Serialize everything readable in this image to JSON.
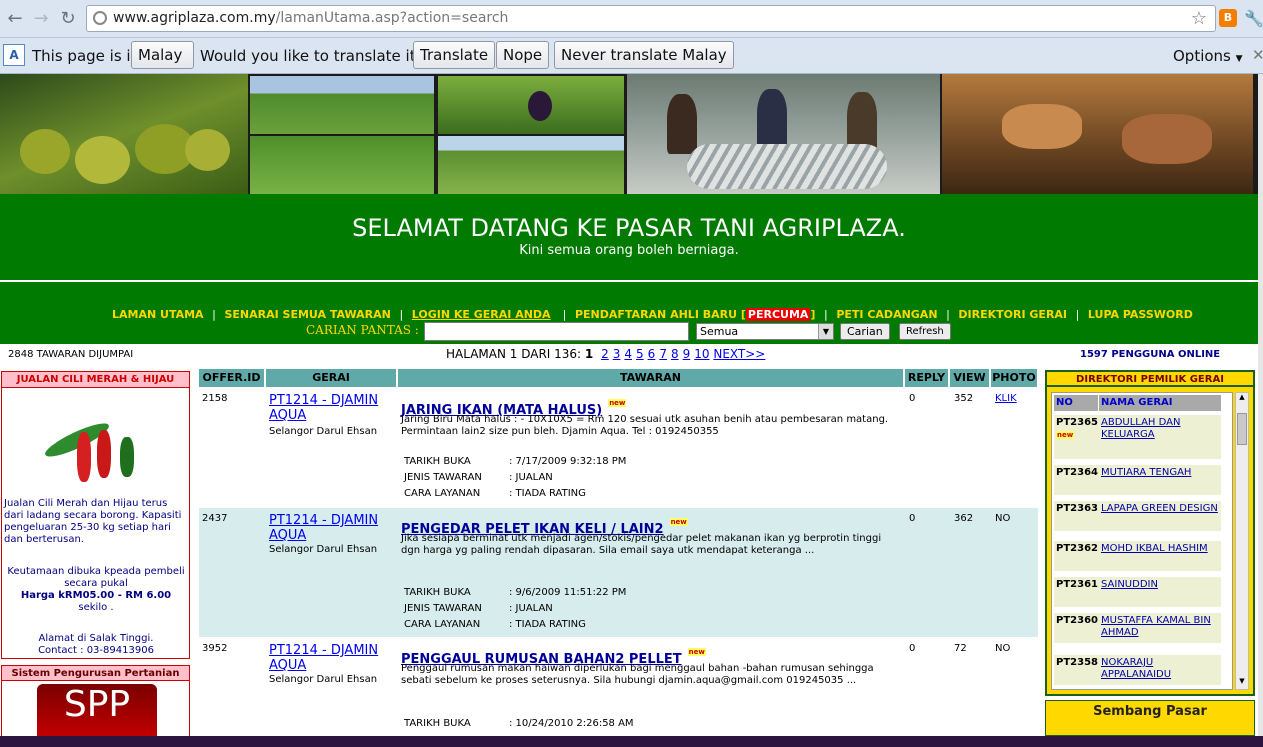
{
  "browser": {
    "url_host": "www.agriplaza.com.my",
    "url_path": "/lamanUtama.asp?action=search",
    "translate_text_prefix": "This page is in",
    "translate_language": "Malay",
    "translate_question": "Would you like to translate it?",
    "translate_btn": "Translate",
    "nope_btn": "Nope",
    "never_btn": "Never translate Malay",
    "options_btn": "Options"
  },
  "site": {
    "welcome_title": "SELAMAT DATANG KE PASAR TANI AGRIPLAZA.",
    "welcome_sub": "Kini semua orang boleh berniaga.",
    "nav": [
      "LAMAN UTAMA",
      "SENARAI SEMUA TAWARAN",
      "LOGIN KE GERAI ANDA",
      "PENDAFTARAN AHLI BARU [",
      "PERCUMA",
      "]",
      "PETI CADANGAN",
      "DIREKTORI GERAI",
      "LUPA PASSWORD"
    ],
    "search_label": "CARIAN PANTAS :",
    "search_value": "",
    "search_select": "Semua",
    "search_btn": "Carian",
    "refresh_btn": "Refresh"
  },
  "summary": {
    "offers_count": "2848 TAWARAN DIJUMPAI",
    "page_label": "HALAMAN 1 DARI 136:",
    "current_page": "1",
    "pages": [
      "2",
      "3",
      "4",
      "5",
      "6",
      "7",
      "8",
      "9",
      "10"
    ],
    "next": "NEXT>>",
    "online": "1597 PENGGUNA ONLINE"
  },
  "left_ad": {
    "title": "JUALAN CILI MERAH & HIJAU",
    "text1": "Jualan Cili Merah dan Hijau terus dari ladang secara borong. Kapasiti pengeluaran 25-30 kg setiap hari dan berterusan.",
    "text2": "Keutamaan dibuka kpeada pembeli secara pukal",
    "price": "Harga kRM05.00 - RM 6.00",
    "unit": "sekilo .",
    "address": "Alamat di Salak Tinggi.",
    "contact": "Contact : 03-89413906",
    "box2_title": "Sistem Pengurusan Pertanian",
    "box2_logo": "SPP"
  },
  "table": {
    "headers": [
      "OFFER.ID",
      "GERAI",
      "TAWARAN",
      "REPLY",
      "VIEW",
      "PHOTO"
    ],
    "new_badge": "new",
    "meta_labels": [
      "TARIKH BUKA",
      "JENIS TAWARAN",
      "CARA LAYANAN"
    ],
    "rows": [
      {
        "id": "2158",
        "shop": "PT1214 - DJAMIN AQUA",
        "state": "Selangor Darul Ehsan",
        "title": "JARING IKAN (MATA HALUS)",
        "desc": "Jaring Biru Mata halus : - 10X10X5 = Rm 120 sesuai utk asuhan benih atau pembesaran matang. Permintaan lain2 size pun bleh. Djamin Aqua. Tel : 0192450355",
        "date": ": 7/17/2009 9:32:18 PM",
        "type": ": JUALAN",
        "rating": ": TIADA RATING",
        "reply": "0",
        "view": "352",
        "photo": "KLIK"
      },
      {
        "id": "2437",
        "shop": "PT1214 - DJAMIN AQUA",
        "state": "Selangor Darul Ehsan",
        "title": "PENGEDAR PELET IKAN KELI / LAIN2",
        "desc": "Jika sesiapa berminat utk menjadi agen/stokis/pengedar pelet makanan ikan yg berprotin tinggi dgn harga yg paling rendah dipasaran. Sila email saya utk mendapat keterangа ...",
        "date": ": 9/6/2009 11:51:22 PM",
        "type": ": JUALAN",
        "rating": ": TIADA RATING",
        "reply": "0",
        "view": "362",
        "photo": "NO"
      },
      {
        "id": "3952",
        "shop": "PT1214 - DJAMIN AQUA",
        "state": "Selangor Darul Ehsan",
        "title": "PENGGAUL RUMUSAN BAHAN2 PELLET",
        "desc": "Penggaul rumusan makan haiwan diperlukan bagi menggaul bahan -bahan rumusan sehingga sebati sebelum ke proses seterusnya. Sila hubungi djamin.aqua@gmail.com 019245035 ...",
        "date": ": 10/24/2010 2:26:58 AM",
        "reply": "0",
        "view": "72",
        "photo": "NO"
      }
    ]
  },
  "directory": {
    "title": "DIREKTORI PEMILIK GERAI",
    "col_no": "NO",
    "col_name": "NAMA GERAI",
    "entries": [
      {
        "no": "PT2365",
        "name": "ABDULLAH DAN KELUARGA"
      },
      {
        "no": "PT2364",
        "name": "MUTIARA TENGAH"
      },
      {
        "no": "PT2363",
        "name": "LAPAPA GREEN DESIGN"
      },
      {
        "no": "PT2362",
        "name": "MOHD IKBAL HASHIM"
      },
      {
        "no": "PT2361",
        "name": "SAINUDDIN"
      },
      {
        "no": "PT2360",
        "name": "MUSTAFFA KAMAL BIN AHMAD"
      },
      {
        "no": "PT2358",
        "name": "NOKARAJU APPALANAIDU"
      }
    ],
    "chat_title": "Sembang Pasar"
  },
  "colors": {
    "green": "#007a00",
    "yellow_link": "#ffd700",
    "teal_header": "#5faaa9"
  }
}
